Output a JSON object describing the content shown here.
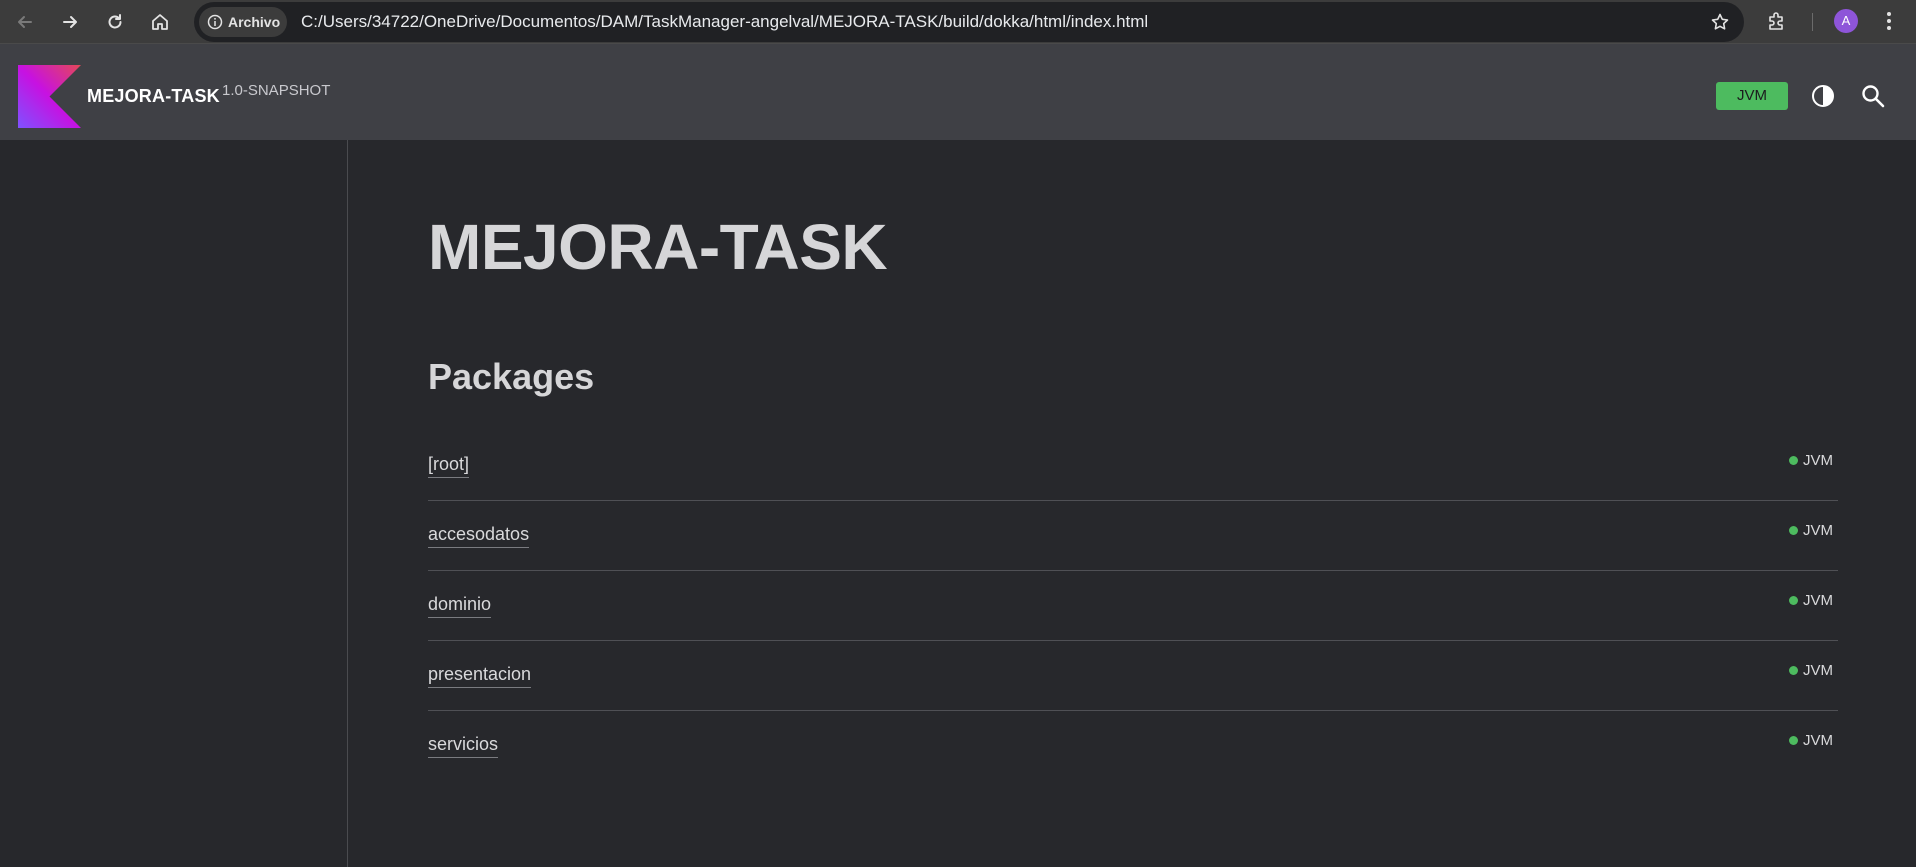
{
  "browser": {
    "site_chip": "Archivo",
    "url": "C:/Users/34722/OneDrive/Documentos/DAM/TaskManager-angelval/MEJORA-TASK/build/dokka/html/index.html",
    "avatar_letter": "A",
    "nav_icons": [
      "back-arrow-icon",
      "forward-arrow-icon",
      "reload-icon",
      "home-icon"
    ]
  },
  "header": {
    "project_name": "MEJORA-TASK",
    "version": "1.0-SNAPSHOT",
    "platform_filter": "JVM",
    "accent_color": "#4dbb5f"
  },
  "main": {
    "title": "MEJORA-TASK",
    "section_title": "Packages",
    "packages": [
      {
        "name": "[root]",
        "platform": "JVM"
      },
      {
        "name": "accesodatos",
        "platform": "JVM"
      },
      {
        "name": "dominio",
        "platform": "JVM"
      },
      {
        "name": "presentacion",
        "platform": "JVM"
      },
      {
        "name": "servicios",
        "platform": "JVM"
      }
    ]
  }
}
